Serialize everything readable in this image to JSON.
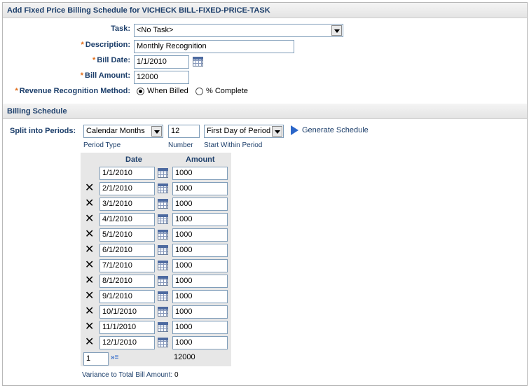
{
  "header": {
    "title": "Add Fixed Price Billing Schedule for VICHECK BILL-FIXED-PRICE-TASK"
  },
  "form": {
    "task_label": "Task:",
    "task_value": "<No Task>",
    "description_label": "Description:",
    "description_value": "Monthly Recognition",
    "bill_date_label": "Bill Date:",
    "bill_date_value": "1/1/2010",
    "bill_amount_label": "Bill Amount:",
    "bill_amount_value": "12000",
    "revenue_label": "Revenue Recognition Method:",
    "radio_when_billed": "When Billed",
    "radio_percent_complete": "% Complete",
    "selected_method": "When Billed",
    "required_marker": "*"
  },
  "billing": {
    "title": "Billing Schedule",
    "split_label": "Split into Periods:",
    "period_type_value": "Calendar Months",
    "period_type_caption": "Period Type",
    "number_value": "12",
    "number_caption": "Number",
    "start_value": "First Day of Period",
    "start_caption": "Start Within Period",
    "generate_label": "Generate Schedule"
  },
  "schedule": {
    "col_date": "Date",
    "col_amount": "Amount",
    "rows": [
      {
        "date": "1/1/2010",
        "amount": "1000"
      },
      {
        "date": "2/1/2010",
        "amount": "1000"
      },
      {
        "date": "3/1/2010",
        "amount": "1000"
      },
      {
        "date": "4/1/2010",
        "amount": "1000"
      },
      {
        "date": "5/1/2010",
        "amount": "1000"
      },
      {
        "date": "6/1/2010",
        "amount": "1000"
      },
      {
        "date": "7/1/2010",
        "amount": "1000"
      },
      {
        "date": "8/1/2010",
        "amount": "1000"
      },
      {
        "date": "9/1/2010",
        "amount": "1000"
      },
      {
        "date": "10/1/2010",
        "amount": "1000"
      },
      {
        "date": "11/1/2010",
        "amount": "1000"
      },
      {
        "date": "12/1/2010",
        "amount": "1000"
      }
    ],
    "add_rows_value": "1",
    "total": "12000",
    "variance_label": "Variance to Total Bill Amount:",
    "variance_value": "0"
  },
  "icons": {
    "delete": "x-icon",
    "calendar": "calendar-icon",
    "generate": "play-icon",
    "add_rows": "add-rows-icon"
  },
  "colors": {
    "label": "#1d3f6b",
    "required": "#e06b16",
    "accent": "#2b66c9"
  }
}
